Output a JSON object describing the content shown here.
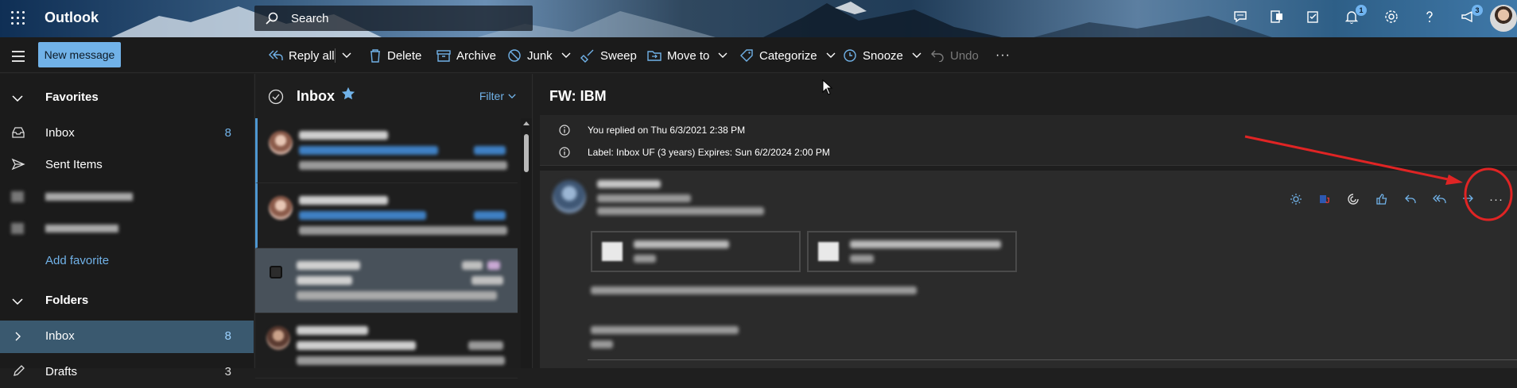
{
  "app": {
    "brand": "Outlook"
  },
  "search": {
    "placeholder": "Search"
  },
  "topbar": {
    "icons": [
      {
        "name": "chat-icon"
      },
      {
        "name": "office-app-icon"
      },
      {
        "name": "tasks-icon"
      },
      {
        "name": "bell-icon",
        "badge": "1"
      },
      {
        "name": "gear-icon"
      },
      {
        "name": "help-icon"
      },
      {
        "name": "megaphone-icon",
        "badge": "3"
      }
    ]
  },
  "toolbar": {
    "new_message": "New message",
    "reply_all": "Reply all",
    "delete": "Delete",
    "archive": "Archive",
    "junk": "Junk",
    "sweep": "Sweep",
    "move_to": "Move to",
    "categorize": "Categorize",
    "snooze": "Snooze",
    "undo": "Undo",
    "more": "···"
  },
  "nav": {
    "favorites_header": "Favorites",
    "favorites": [
      {
        "label": "Inbox",
        "count": "8",
        "icon": "inbox-icon"
      },
      {
        "label": "Sent Items",
        "count": "",
        "icon": "send-icon"
      }
    ],
    "add_favorite": "Add favorite",
    "folders_header": "Folders",
    "folders": [
      {
        "label": "Inbox",
        "count": "8",
        "icon": "chevron-right-icon",
        "selected": true
      },
      {
        "label": "Drafts",
        "count": "3",
        "icon": "pencil-icon"
      }
    ]
  },
  "list": {
    "title": "Inbox",
    "filter": "Filter"
  },
  "reading": {
    "subject": "FW: IBM",
    "info": [
      "You replied on Thu 6/3/2021 2:38 PM",
      "Label: Inbox UF (3 years) Expires: Sun 6/2/2024 2:00 PM"
    ],
    "more_actions": "···"
  },
  "colors": {
    "accent": "#71b2e8",
    "selected_folder": "#3a596f",
    "annotation": "#e02424"
  }
}
